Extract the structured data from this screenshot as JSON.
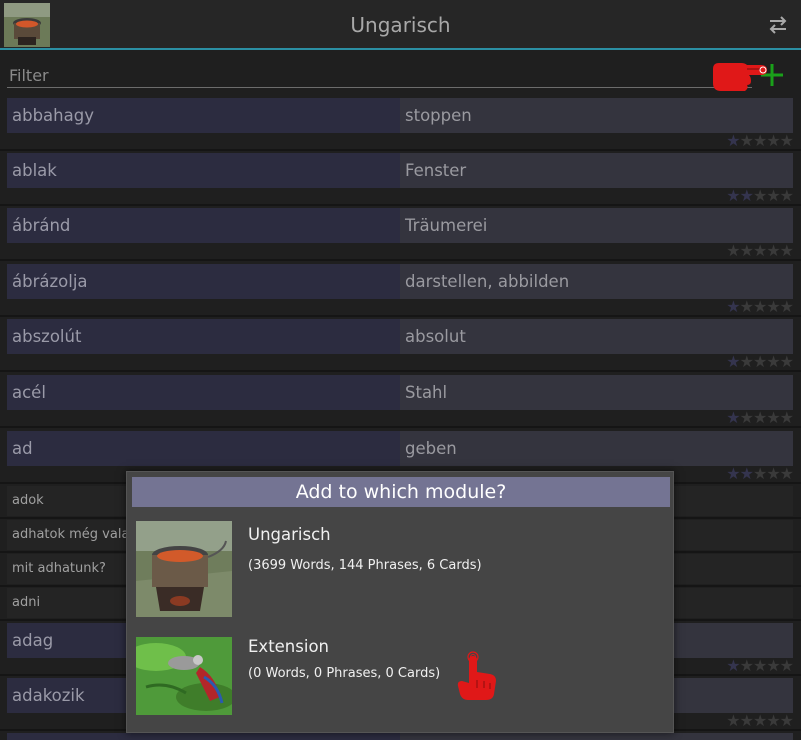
{
  "header": {
    "title": "Ungarisch",
    "swap_icon": "swap-arrows-icon"
  },
  "filter": {
    "placeholder": "Filter",
    "value": ""
  },
  "add_icon": "plus-icon",
  "colors": {
    "accent": "#2b8fa3",
    "plus": "#1aa01a",
    "hand": "#e01818",
    "dialog_title_bg": "#747493"
  },
  "entries": [
    {
      "left": "abbahagy",
      "right": "stoppen",
      "rating": 1
    },
    {
      "left": "ablak",
      "right": "Fenster",
      "rating": 2
    },
    {
      "left": "ábránd",
      "right": "Träumerei",
      "rating": 0
    },
    {
      "left": "ábrázolja",
      "right": "darstellen, abbilden",
      "rating": 1
    },
    {
      "left": "abszolút",
      "right": "absolut",
      "rating": 1
    },
    {
      "left": "acél",
      "right": "Stahl",
      "rating": 1
    },
    {
      "left": "ad",
      "right": "geben",
      "rating": 2
    }
  ],
  "phrases": [
    {
      "left": "adok"
    },
    {
      "left": "adhatok még valar"
    },
    {
      "left": "mit adhatunk?"
    },
    {
      "left": "adni"
    }
  ],
  "entries_bottom": [
    {
      "left": "adag",
      "rating": 1
    },
    {
      "left": "adakozik",
      "rating": 0
    }
  ],
  "dialog": {
    "title": "Add to which module?",
    "modules": [
      {
        "name": "Ungarisch",
        "stats": "(3699 Words, 144 Phrases, 6 Cards)",
        "image": "cooking-pot-photo"
      },
      {
        "name": "Extension",
        "stats": "(0 Words, 0 Phrases, 0 Cards)",
        "image": "parrot-photo"
      }
    ]
  }
}
